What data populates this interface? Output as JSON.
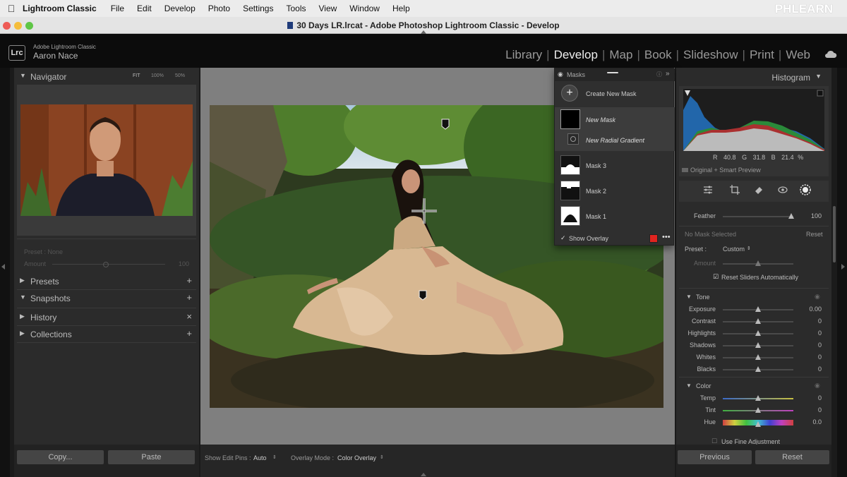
{
  "menubar": {
    "app": "Lightroom Classic",
    "items": [
      "File",
      "Edit",
      "Develop",
      "Photo",
      "Settings",
      "Tools",
      "View",
      "Window",
      "Help"
    ],
    "brand": "PHLEARN"
  },
  "window": {
    "title": "30 Days LR.lrcat - Adobe Photoshop Lightroom Classic - Develop"
  },
  "identity": {
    "logo": "Lrc",
    "product": "Adobe Lightroom Classic",
    "user": "Aaron Nace"
  },
  "modules": [
    "Library",
    "Develop",
    "Map",
    "Book",
    "Slideshow",
    "Print",
    "Web"
  ],
  "left_panel": {
    "navigator": {
      "title": "Navigator",
      "zoom_fit": "FIT",
      "zoom_100": "100%",
      "zoom_50": "50%"
    },
    "preset_label": "Preset : None",
    "amount_label": "Amount",
    "amount_value": "100",
    "sections": [
      {
        "label": "Presets",
        "action": "+"
      },
      {
        "label": "Snapshots",
        "action": "+"
      },
      {
        "label": "History",
        "action": "×"
      },
      {
        "label": "Collections",
        "action": "+"
      }
    ],
    "copy_label": "Copy...",
    "paste_label": "Paste"
  },
  "toolbar": {
    "edit_pins_label": "Show Edit Pins :",
    "edit_pins_value": "Auto",
    "overlay_label": "Overlay Mode :",
    "overlay_value": "Color Overlay"
  },
  "masks_panel": {
    "title": "Masks",
    "create_label": "Create New Mask",
    "new_mask": "New Mask",
    "new_radial": "New Radial Gradient",
    "masks": [
      "Mask 3",
      "Mask 2",
      "Mask 1"
    ],
    "show_overlay": "Show Overlay",
    "overlay_color": "#e0241f"
  },
  "right_panel": {
    "histogram": {
      "title": "Histogram",
      "r_label": "R",
      "r_value": "40.8",
      "g_label": "G",
      "g_value": "31.8",
      "b_label": "B",
      "b_value": "21.4",
      "percent": "%",
      "preview_label": "Original + Smart Preview"
    },
    "feather": {
      "label": "Feather",
      "value": "100",
      "pct": 0.97
    },
    "no_mask": "No Mask Selected",
    "reset_label": "Reset",
    "preset_label": "Preset :",
    "preset_value": "Custom",
    "amount_label": "Amount",
    "amount_pct": 0.5,
    "reset_auto": "Reset Sliders Automatically",
    "tone": {
      "title": "Tone",
      "sliders": [
        {
          "label": "Exposure",
          "value": "0.00",
          "pct": 0.5
        },
        {
          "label": "Contrast",
          "value": "0",
          "pct": 0.5
        },
        {
          "label": "Highlights",
          "value": "0",
          "pct": 0.5
        },
        {
          "label": "Shadows",
          "value": "0",
          "pct": 0.5
        },
        {
          "label": "Whites",
          "value": "0",
          "pct": 0.5
        },
        {
          "label": "Blacks",
          "value": "0",
          "pct": 0.5
        }
      ]
    },
    "color": {
      "title": "Color",
      "sliders": [
        {
          "label": "Temp",
          "value": "0",
          "pct": 0.5
        },
        {
          "label": "Tint",
          "value": "0",
          "pct": 0.5
        },
        {
          "label": "Hue",
          "value": "0.0",
          "pct": 0.5
        }
      ],
      "fine_adjust": "Use Fine Adjustment"
    },
    "previous_label": "Previous",
    "reset_button_label": "Reset"
  }
}
